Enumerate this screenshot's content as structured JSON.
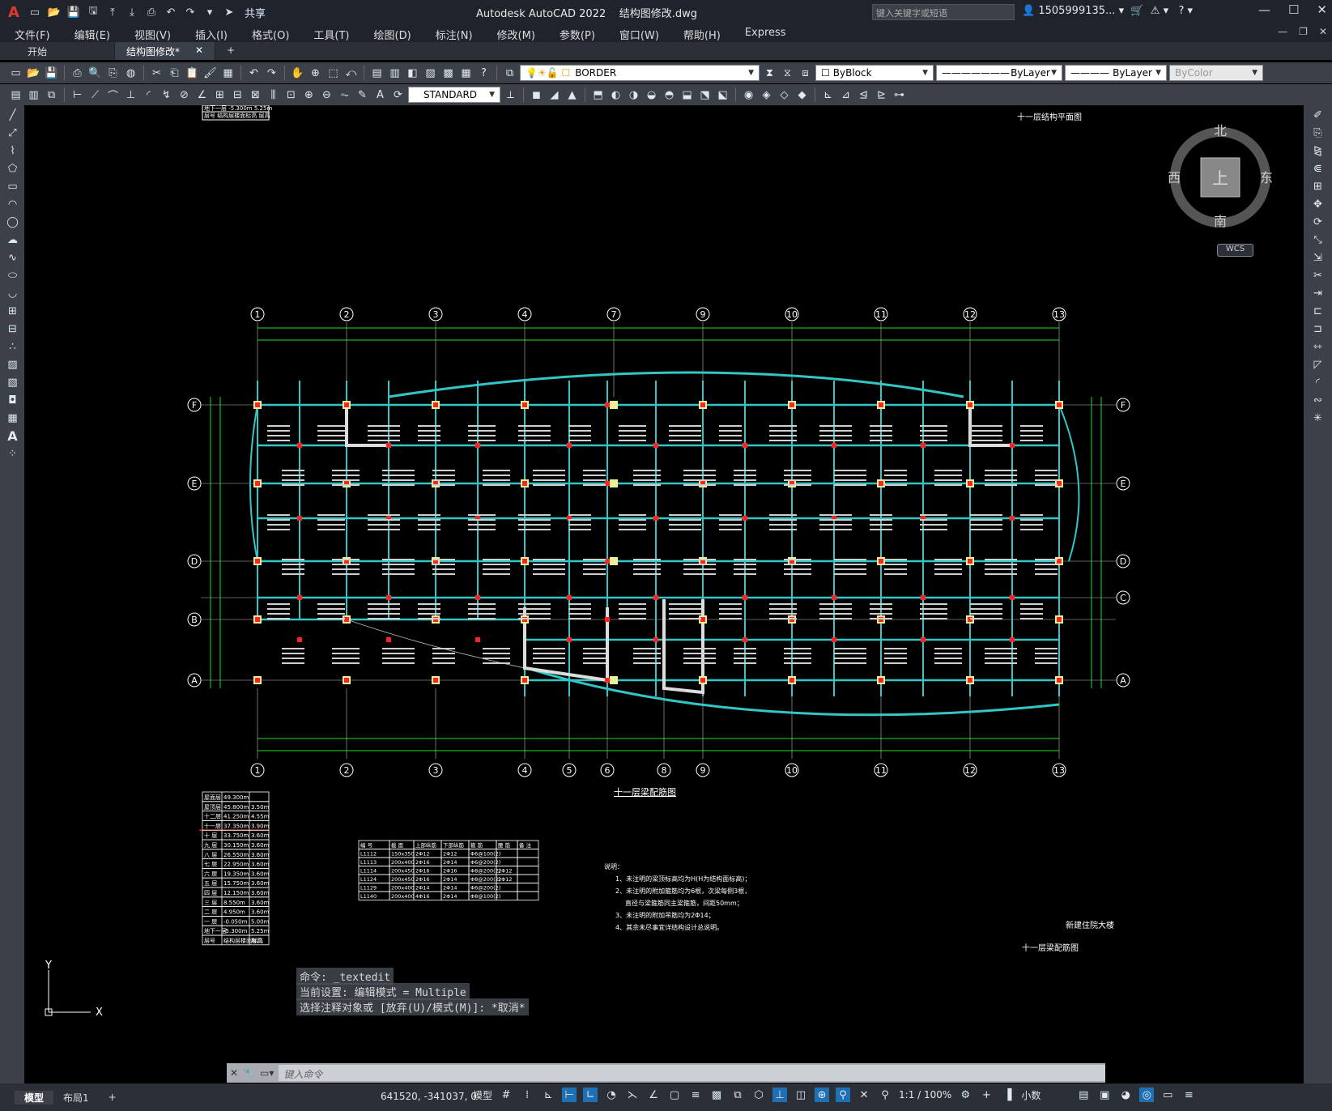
{
  "app": {
    "title": "Autodesk AutoCAD 2022",
    "filename": "结构图修改.dwg",
    "share_label": "共享",
    "search_placeholder": "键入关键字或短语",
    "user": "1505999135..."
  },
  "menu": [
    "文件(F)",
    "编辑(E)",
    "视图(V)",
    "插入(I)",
    "格式(O)",
    "工具(T)",
    "绘图(D)",
    "标注(N)",
    "修改(M)",
    "参数(P)",
    "窗口(W)",
    "帮助(H)",
    "Express"
  ],
  "doc_tabs": {
    "start": "开始",
    "active": "结构图修改*",
    "add": "+"
  },
  "toolbar": {
    "layer": "BORDER",
    "color": "ByBlock",
    "linetype": "ByLayer",
    "lineweight": "ByLayer",
    "plotstyle": "ByColor",
    "textstyle": "STANDARD"
  },
  "viewcube": {
    "top": "上",
    "north": "北",
    "south": "南",
    "east": "东",
    "west": "西",
    "wcs": "WCS"
  },
  "drawing": {
    "top_title": "十一层结构平面图",
    "plan_title": "十一层梁配筋图",
    "project": "新建住院大楼",
    "bottom_title": "十一层梁配筋图",
    "axes_top": [
      "1",
      "2",
      "3",
      "4",
      "7",
      "9",
      "10",
      "11",
      "12",
      "13"
    ],
    "axes_bottom": [
      "1",
      "2",
      "3",
      "4",
      "5",
      "6",
      "8",
      "9",
      "10",
      "11",
      "12",
      "13"
    ],
    "axes_left": [
      "F",
      "E",
      "D",
      "B",
      "A"
    ],
    "axes_right": [
      "F",
      "E",
      "D",
      "C",
      "A"
    ],
    "notes_title": "说明：",
    "notes": [
      "1、未注明的梁顶标高均为H(H为结构面标高)；",
      "2、未注明的附加箍筋均为6根，次梁每侧3根，",
      "直径与梁箍筋同主梁箍筋，间距50mm；",
      "3、未注明的附加吊筋均为2Φ14；",
      "4、其余未尽事宜详结构设计总说明。"
    ],
    "level_table": [
      [
        "屋面层",
        "49.300m",
        ""
      ],
      [
        "屋顶层",
        "45.800m",
        "3.50m"
      ],
      [
        "十二层",
        "41.250m",
        "4.55m"
      ],
      [
        "十一层",
        "37.350m",
        "3.90m"
      ],
      [
        "十 层",
        "33.750m",
        "3.60m"
      ],
      [
        "九 层",
        "30.150m",
        "3.60m"
      ],
      [
        "八 层",
        "26.550m",
        "3.60m"
      ],
      [
        "七 层",
        "22.950m",
        "3.60m"
      ],
      [
        "六 层",
        "19.350m",
        "3.60m"
      ],
      [
        "五 层",
        "15.750m",
        "3.60m"
      ],
      [
        "四 层",
        "12.150m",
        "3.60m"
      ],
      [
        "三 层",
        "8.550m",
        "3.60m"
      ],
      [
        "二 层",
        "4.950m",
        "3.60m"
      ],
      [
        "一 层",
        "-0.050m",
        "5.00m"
      ],
      [
        "地下一层",
        "-5.300m",
        "5.25m"
      ],
      [
        "层号",
        "结构层楼面标高",
        "层高"
      ]
    ],
    "beam_table_header": [
      "编 号",
      "截 面",
      "上部纵筋",
      "下部纵筋",
      "箍 筋",
      "腰 筋",
      "备 注"
    ],
    "beam_table": [
      [
        "L1112",
        "150x350",
        "2Φ12",
        "2Φ12",
        "Φ6@100(2)",
        "",
        ""
      ],
      [
        "L1113",
        "200x400",
        "2Φ16",
        "2Φ14",
        "Φ6@200(2)",
        "",
        ""
      ],
      [
        "L1114",
        "200x450",
        "2Φ16",
        "2Φ16",
        "Φ8@200(2)",
        "2Φ12",
        ""
      ],
      [
        "L1124",
        "200x450",
        "2Φ16",
        "2Φ14",
        "Φ8@200(2)",
        "2Φ12",
        ""
      ],
      [
        "L1129",
        "200x400",
        "2Φ14",
        "2Φ14",
        "Φ6@200(2)",
        "",
        ""
      ],
      [
        "L1140",
        "200x400",
        "4Φ16",
        "2Φ14",
        "Φ8@100(2)",
        "",
        ""
      ]
    ],
    "top_fragment": [
      "地下一层  -5.300m  5.25m",
      "层号  结构层楼面标高  层高"
    ]
  },
  "ucs": {
    "x": "X",
    "y": "Y"
  },
  "command": {
    "history": [
      "命令: _textedit",
      "当前设置: 编辑模式 = Multiple",
      "选择注释对象或 [放弃(U)/模式(M)]: *取消*"
    ],
    "placeholder": "键入命令"
  },
  "status": {
    "tab_model": "模型",
    "tab_layout": "布局1",
    "coords": "641520, -341037, 0",
    "space": "模型",
    "scale": "1:1 / 100%",
    "units": "小数"
  }
}
